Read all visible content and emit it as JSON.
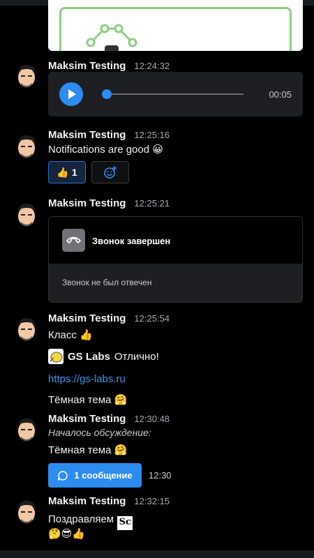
{
  "messages": [
    {
      "author": "Maksim Testing",
      "time": "12:24:32",
      "audio_duration": "00:05",
      "audio_progress": 0.0
    },
    {
      "author": "Maksim Testing",
      "time": "12:25:16",
      "text": "Notifications are good 😀",
      "reactions": [
        {
          "emoji": "👍",
          "count": "1"
        }
      ]
    },
    {
      "author": "Maksim Testing",
      "time": "12:25:21",
      "call_title": "Звонок завершен",
      "call_status": "Звонок не был отвечен"
    },
    {
      "author": "Maksim Testing",
      "time": "12:25:54",
      "text": "Класс 👍",
      "forward_name": "GS Labs",
      "forward_text": "Отлично!",
      "link": "https://gs-labs.ru",
      "text2": "Тёмная тема 🤗"
    },
    {
      "author": "Maksim Testing",
      "time": "12:30:48",
      "thread_started": "Началось обсуждение:",
      "text": "Тёмная тема 🤗",
      "thread_button": "1 сообщение",
      "thread_time": "12:30"
    },
    {
      "author": "Maksim Testing",
      "time": "12:32:15",
      "text": "Поздравляем",
      "emoji_line": "🤔😎👍",
      "sticker_label": "Sc"
    }
  ],
  "colors": {
    "accent": "#2d8cf0",
    "background": "#000000",
    "card": "#1e1f22",
    "link": "#3b95e8"
  }
}
